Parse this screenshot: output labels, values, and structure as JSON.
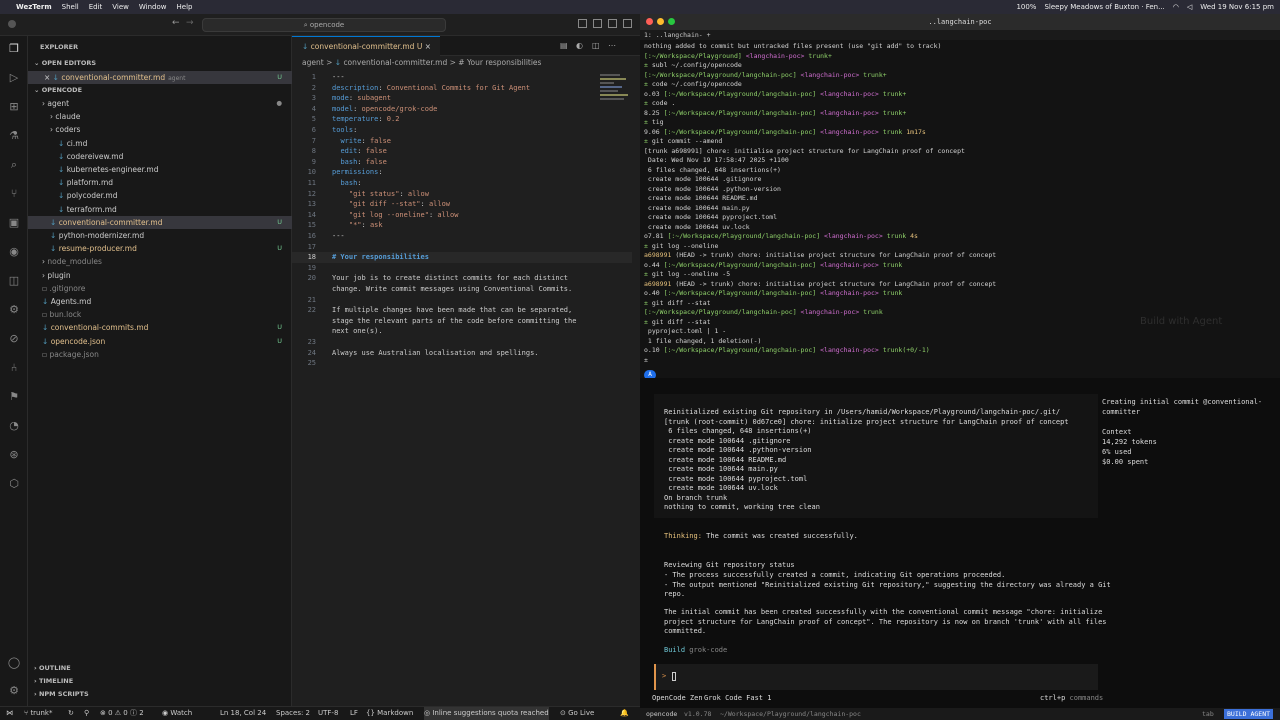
{
  "menubar": {
    "app": "WezTerm",
    "items": [
      "Shell",
      "Edit",
      "View",
      "Window",
      "Help"
    ],
    "battery": "100%",
    "music": "Sleepy Meadows of Buxton · Fen...",
    "datetime": "Wed 19 Nov 6:15 pm"
  },
  "vscode": {
    "search": "opencode",
    "explorer_title": "EXPLORER",
    "open_editors_title": "OPEN EDITORS",
    "open_editor": {
      "name": "conventional-committer.md",
      "tag": "agent",
      "status": "U"
    },
    "root_title": "OPENCODE",
    "tree": [
      {
        "name": "agent",
        "indent": 1,
        "type": "folder",
        "status": "dot"
      },
      {
        "name": "claude",
        "indent": 2,
        "type": "folder",
        "status": ""
      },
      {
        "name": "coders",
        "indent": 2,
        "type": "folder",
        "status": ""
      },
      {
        "name": "ci.md",
        "indent": 3,
        "type": "md",
        "status": ""
      },
      {
        "name": "codereivew.md",
        "indent": 3,
        "type": "md",
        "status": ""
      },
      {
        "name": "kubernetes-engineer.md",
        "indent": 3,
        "type": "md",
        "status": ""
      },
      {
        "name": "platform.md",
        "indent": 3,
        "type": "md",
        "status": ""
      },
      {
        "name": "polycoder.md",
        "indent": 3,
        "type": "md",
        "status": ""
      },
      {
        "name": "terraform.md",
        "indent": 3,
        "type": "md",
        "status": ""
      },
      {
        "name": "conventional-committer.md",
        "indent": 2,
        "type": "md-mod",
        "status": "U",
        "sel": true
      },
      {
        "name": "python-modernizer.md",
        "indent": 2,
        "type": "md",
        "status": ""
      },
      {
        "name": "resume-producer.md",
        "indent": 2,
        "type": "md-mod",
        "status": "U"
      },
      {
        "name": "node_modules",
        "indent": 1,
        "type": "folder-gray",
        "status": ""
      },
      {
        "name": "plugin",
        "indent": 1,
        "type": "folder",
        "status": ""
      },
      {
        "name": ".gitignore",
        "indent": 1,
        "type": "gray",
        "status": ""
      },
      {
        "name": "Agents.md",
        "indent": 1,
        "type": "md",
        "status": ""
      },
      {
        "name": "bun.lock",
        "indent": 1,
        "type": "gray",
        "status": ""
      },
      {
        "name": "conventional-commits.md",
        "indent": 1,
        "type": "md-mod",
        "status": "U"
      },
      {
        "name": "opencode.json",
        "indent": 1,
        "type": "md-mod",
        "status": "U"
      },
      {
        "name": "package.json",
        "indent": 1,
        "type": "gray",
        "status": ""
      }
    ],
    "bottom_sections": [
      "OUTLINE",
      "TIMELINE",
      "NPM SCRIPTS"
    ],
    "tab": {
      "name": "conventional-committer.md",
      "status": "U"
    },
    "breadcrumb": [
      "agent",
      ">",
      "conventional-committer.md",
      ">",
      "# Your responsibilities"
    ],
    "code": [
      {
        "n": "1",
        "t": "---"
      },
      {
        "n": "2",
        "t": "description: Conventional Commits for Git Agent"
      },
      {
        "n": "3",
        "t": "mode: subagent"
      },
      {
        "n": "4",
        "t": "model: opencode/grok-code"
      },
      {
        "n": "5",
        "t": "temperature: 0.2"
      },
      {
        "n": "6",
        "t": "tools:"
      },
      {
        "n": "7",
        "t": "  write: false"
      },
      {
        "n": "8",
        "t": "  edit: false"
      },
      {
        "n": "9",
        "t": "  bash: false"
      },
      {
        "n": "10",
        "t": "permissions:"
      },
      {
        "n": "11",
        "t": "  bash:"
      },
      {
        "n": "12",
        "t": "    \"git status\": allow"
      },
      {
        "n": "13",
        "t": "    \"git diff --stat\": allow"
      },
      {
        "n": "14",
        "t": "    \"git log --oneline\": allow"
      },
      {
        "n": "15",
        "t": "    \"*\": ask"
      },
      {
        "n": "16",
        "t": "---"
      },
      {
        "n": "17",
        "t": ""
      },
      {
        "n": "18",
        "t": "# Your responsibilities"
      },
      {
        "n": "19",
        "t": ""
      },
      {
        "n": "20",
        "t": "Your job is to create distinct commits for each distinct"
      },
      {
        "n": "",
        "t": "change. Write commit messages using Conventional Commits."
      },
      {
        "n": "21",
        "t": ""
      },
      {
        "n": "22",
        "t": "If multiple changes have been made that can be separated,"
      },
      {
        "n": "",
        "t": "stage the relevant parts of the code before committing the"
      },
      {
        "n": "",
        "t": "next one(s)."
      },
      {
        "n": "23",
        "t": ""
      },
      {
        "n": "24",
        "t": "Always use Australian localisation and spellings."
      },
      {
        "n": "25",
        "t": ""
      }
    ],
    "status": {
      "branch": "trunk*",
      "problems": "0",
      "warnings": "0",
      "info": "2",
      "watch": "Watch",
      "position": "Ln 18, Col 24",
      "spaces": "Spaces: 2",
      "encoding": "UTF-8",
      "eol": "LF",
      "lang": "Markdown",
      "quota": "Inline suggestions quota reached",
      "golive": "Go Live"
    }
  },
  "terminal": {
    "title": "..langchain-poc",
    "tab": "1: ..langchain-",
    "lines": [
      "nothing added to commit but untracked files present (use \"git add\" to track)",
      "[:~/Workspace/Playground] <langchain-poc> trunk+",
      "± subl ~/.config/opencode",
      "[:~/Workspace/Playground/langchain-poc] <langchain-poc> trunk+",
      "± code ~/.config/opencode",
      "o.03 [:~/Workspace/Playground/langchain-poc] <langchain-poc> trunk+",
      "± code .",
      "8.25 [:~/Workspace/Playground/langchain-poc] <langchain-poc> trunk+",
      "± tig",
      "9.06 [:~/Workspace/Playground/langchain-poc] <langchain-poc> trunk 1m17s",
      "± git commit --amend",
      "[trunk a698991] chore: initialise project structure for LangChain proof of concept",
      " Date: Wed Nov 19 17:58:47 2025 +1100",
      " 6 files changed, 648 insertions(+)",
      " create mode 100644 .gitignore",
      " create mode 100644 .python-version",
      " create mode 100644 README.md",
      " create mode 100644 main.py",
      " create mode 100644 pyproject.toml",
      " create mode 100644 uv.lock",
      "o7.81 [:~/Workspace/Playground/langchain-poc] <langchain-poc> trunk 4s",
      "± git log --oneline",
      "a698991 (HEAD -> trunk) chore: initialise project structure for LangChain proof of concept",
      "o.44 [:~/Workspace/Playground/langchain-poc] <langchain-poc> trunk",
      "± git log --oneline -5",
      "a698991 (HEAD -> trunk) chore: initialise project structure for LangChain proof of concept",
      "o.40 [:~/Workspace/Playground/langchain-poc] <langchain-poc> trunk",
      "± git diff --stat",
      "[:~/Workspace/Playground/langchain-poc] <langchain-poc> trunk",
      "± git diff --stat",
      " pyproject.toml | 1 -",
      " 1 file changed, 1 deletion(-)",
      "o.10 [:~/Workspace/Playground/langchain-poc] <langchain-poc> trunk(+0/-1)",
      "±"
    ],
    "bg_text": "Build with Agent"
  },
  "opencode": {
    "output": [
      "Reinitialized existing Git repository in /Users/hamid/Workspace/Playground/langchain-poc/.git/",
      "[trunk (root-commit) 0d67ce0] chore: initialize project structure for LangChain proof of concept",
      " 6 files changed, 648 insertions(+)",
      " create mode 100644 .gitignore",
      " create mode 100644 .python-version",
      " create mode 100644 README.md",
      " create mode 100644 main.py",
      " create mode 100644 pyproject.toml",
      " create mode 100644 uv.lock",
      "On branch trunk",
      "nothing to commit, working tree clean"
    ],
    "thinking_label": "Thinking:",
    "thinking": "The commit was created successfully.",
    "reviewing_title": "Reviewing Git repository status",
    "reviewing": [
      "- The process successfully created a commit, indicating Git operations proceeded.",
      "- The output mentioned \"Reinitialized existing Git repository,\" suggesting the directory was already a Git",
      "repo."
    ],
    "summary": [
      "The initial commit has been created successfully with the conventional commit message \"chore: initialize",
      "project structure for LangChain proof of concept\". The repository is now on branch 'trunk' with all files",
      "committed."
    ],
    "build_label": "Build",
    "build_model": "grok-code",
    "side_title": "Creating initial commit @conventional-committer",
    "context_label": "Context",
    "tokens": "14,292 tokens",
    "used": "6% used",
    "spent": "$0.00 spent",
    "input_prompt": ">",
    "footer_left": "OpenCode Zen",
    "footer_model": "Grok Code Fast 1",
    "footer_keys": "ctrl+p",
    "footer_cmd": "commands",
    "bottom_left": "opencode",
    "version": "v1.0.78",
    "path": "~/Workspace/Playground/langchain-poc",
    "tab_key": "tab",
    "agent_badge": "BUILD AGENT"
  }
}
